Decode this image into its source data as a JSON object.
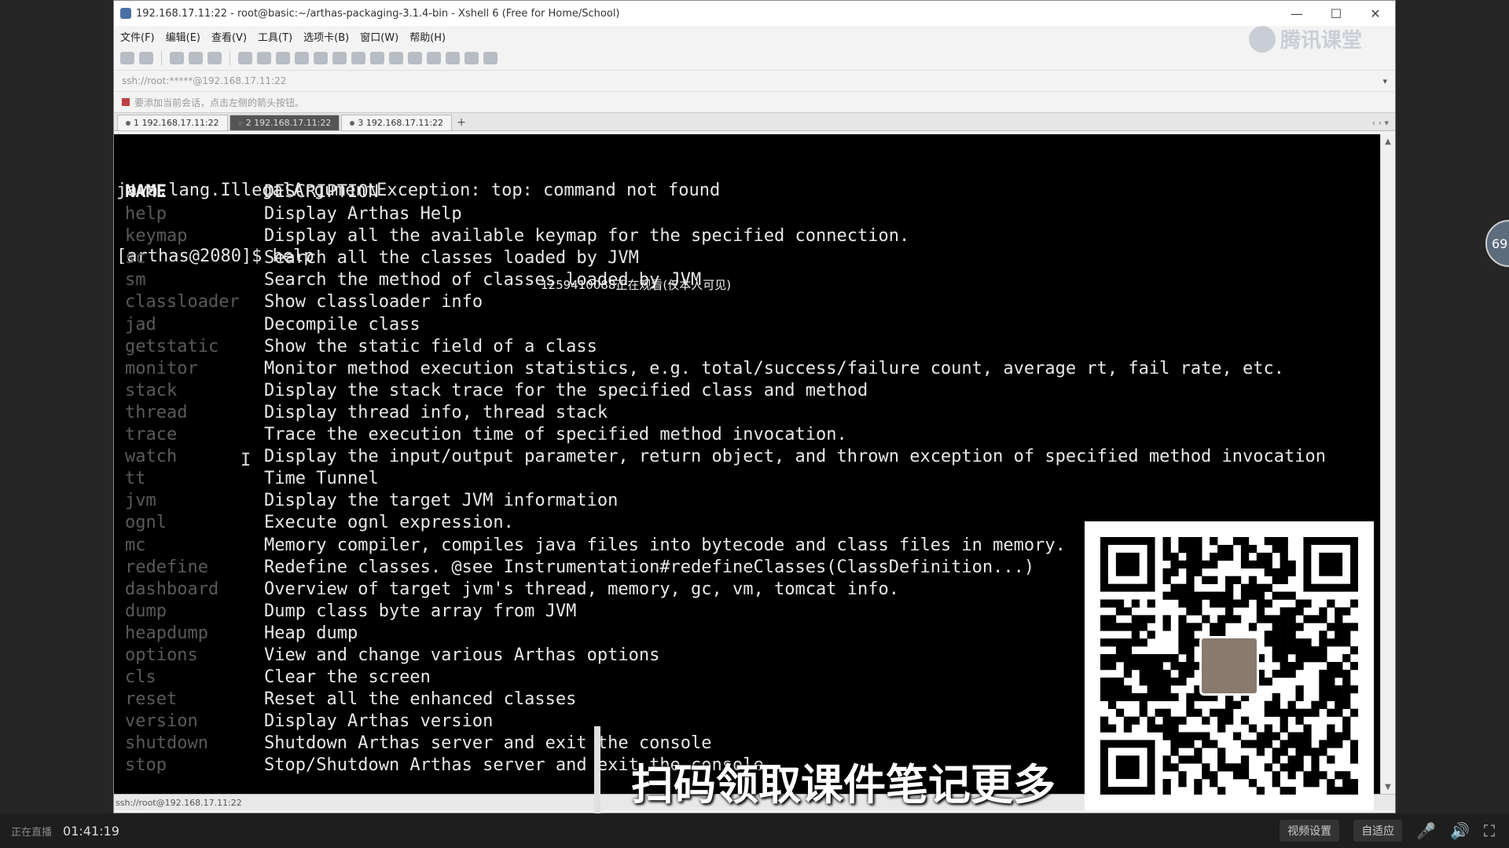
{
  "window": {
    "title": "192.168.17.11:22 - root@basic:~/arthas-packaging-3.1.4-bin - Xshell 6 (Free for Home/School)",
    "minimize": "—",
    "maximize": "☐",
    "close": "✕"
  },
  "menu": [
    "文件(F)",
    "编辑(E)",
    "查看(V)",
    "工具(T)",
    "选项卡(B)",
    "窗口(W)",
    "帮助(H)"
  ],
  "watermark": "腾讯课堂",
  "address": "ssh://root:*****@192.168.17.11:22",
  "hint": "要添加当前会话，点击左侧的箭头按钮。",
  "tabs": [
    {
      "label": "1 192.168.17.11:22"
    },
    {
      "label": "2 192.168.17.11:22"
    },
    {
      "label": "3 192.168.17.11:22"
    }
  ],
  "tab_add": "+",
  "terminal": {
    "line1": "java.lang.IllegalArgumentException: top: command not found",
    "line2": "[arthas@2080]$ help",
    "header": {
      "name": "NAME",
      "desc": "DESCRIPTION"
    },
    "rows": [
      {
        "cmd": "help",
        "desc": "Display Arthas Help"
      },
      {
        "cmd": "keymap",
        "desc": "Display all the available keymap for the specified connection."
      },
      {
        "cmd": "sc",
        "desc": "Search all the classes loaded by JVM"
      },
      {
        "cmd": "sm",
        "desc": "Search the method of classes loaded by JVM"
      },
      {
        "cmd": "classloader",
        "desc": "Show classloader info"
      },
      {
        "cmd": "jad",
        "desc": "Decompile class"
      },
      {
        "cmd": "getstatic",
        "desc": "Show the static field of a class"
      },
      {
        "cmd": "monitor",
        "desc": "Monitor method execution statistics, e.g. total/success/failure count, average rt, fail rate, etc."
      },
      {
        "cmd": "stack",
        "desc": "Display the stack trace for the specified class and method"
      },
      {
        "cmd": "thread",
        "desc": "Display thread info, thread stack"
      },
      {
        "cmd": "trace",
        "desc": "Trace the execution time of specified method invocation."
      },
      {
        "cmd": "watch",
        "desc": "Display the input/output parameter, return object, and thrown exception of specified method invocation"
      },
      {
        "cmd": "tt",
        "desc": "Time Tunnel"
      },
      {
        "cmd": "jvm",
        "desc": "Display the target JVM information"
      },
      {
        "cmd": "ognl",
        "desc": "Execute ognl expression."
      },
      {
        "cmd": "mc",
        "desc": "Memory compiler, compiles java files into bytecode and class files in memory."
      },
      {
        "cmd": "redefine",
        "desc": "Redefine classes. @see Instrumentation#redefineClasses(ClassDefinition...)"
      },
      {
        "cmd": "dashboard",
        "desc": "Overview of target jvm's thread, memory, gc, vm, tomcat info."
      },
      {
        "cmd": "dump",
        "desc": "Dump class byte array from JVM"
      },
      {
        "cmd": "heapdump",
        "desc": "Heap dump"
      },
      {
        "cmd": "options",
        "desc": "View and change various Arthas options"
      },
      {
        "cmd": "cls",
        "desc": "Clear the screen"
      },
      {
        "cmd": "reset",
        "desc": "Reset all the enhanced classes"
      },
      {
        "cmd": "version",
        "desc": "Display Arthas version"
      },
      {
        "cmd": "shutdown",
        "desc": "Shutdown Arthas server and exit the console"
      },
      {
        "cmd": "stop",
        "desc": "Stop/Shutdown Arthas server and exit the console"
      }
    ]
  },
  "viewer_overlay": "1259410088正在观看(仅本人可见)",
  "status_bar": "ssh://root@192.168.17.11:22",
  "subtitle": "扫码领取课件笔记更多",
  "side_badge": "69",
  "player": {
    "live_label": "正在直播",
    "time": "01:41:19",
    "settings_label": "视频设置",
    "adaptive_label": "自适应",
    "mic_icon": "mic-icon",
    "volume_icon": "volume-icon",
    "fullscreen_icon": "fullscreen-icon"
  }
}
